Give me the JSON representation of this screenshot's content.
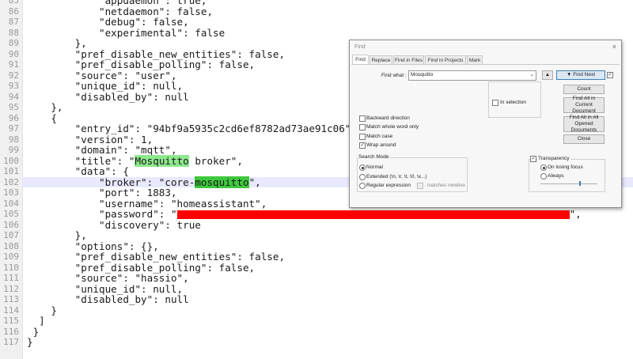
{
  "editor": {
    "first_line": 85,
    "current_line_index": 17,
    "line_numbers": [
      "85",
      "86",
      "87",
      "88",
      "89",
      "90",
      "91",
      "92",
      "93",
      "94",
      "95",
      "96",
      "97",
      "98",
      "99",
      "100",
      "101",
      "102",
      "103",
      "104",
      "105",
      "106",
      "107",
      "108",
      "109",
      "110",
      "111",
      "112",
      "113",
      "114",
      "115",
      "116",
      "117"
    ],
    "lines": [
      "            \"appdaemon\": true,",
      "            \"netdaemon\": false,",
      "            \"debug\": false,",
      "            \"experimental\": false",
      "        },",
      "        \"pref_disable_new_entities\": false,",
      "        \"pref_disable_polling\": false,",
      "        \"source\": \"user\",",
      "        \"unique_id\": null,",
      "        \"disabled_by\": null",
      "    },",
      "    {",
      "        \"entry_id\": \"94bf9a5935c2cd6ef8782ad73ae91c06\",",
      "        \"version\": 1,",
      "        \"domain\": \"mqtt\",",
      "        \"title\": \"",
      "        \"data\": {",
      "            \"broker\": \"core-",
      "            \"port\": 1883,",
      "            \"username\": \"homeassistant\",",
      "            \"password\": \"",
      "            \"discovery\": true",
      "        },",
      "        \"options\": {},",
      "        \"pref_disable_new_entities\": false,",
      "        \"pref_disable_polling\": false,",
      "        \"source\": \"hassio\",",
      "        \"unique_id\": null,",
      "        \"disabled_by\": null",
      "    }",
      "  ]",
      " }",
      "}"
    ],
    "title_match": "Mosquitto",
    "title_rest": " broker\",",
    "broker_match": "mosquitto",
    "broker_rest": "\",",
    "password_rest": "\","
  },
  "find_dialog": {
    "title": "Find",
    "close": "×",
    "tabs": [
      "Find",
      "Replace",
      "Find in Files",
      "Find in Projects",
      "Mark"
    ],
    "find_what_label": "Find what :",
    "find_what_value": "Mosquitto",
    "up_arrow": "▲",
    "find_next": "▼ Find Next",
    "count": "Count",
    "find_all_current": "Find All in Current Document",
    "find_all_opened": "Find All in All Opened Documents",
    "close_btn": "Close",
    "in_selection": "In selection",
    "backward": "Backward direction",
    "whole_word": "Match whole word only",
    "match_case": "Match case",
    "wrap_around": "Wrap around",
    "search_mode_title": "Search Mode",
    "mode_normal": "Normal",
    "mode_extended": "Extended (\\n, \\r, \\t, \\0, \\x...)",
    "mode_regex": "Regular expression",
    "matches_newline": ". matches newline",
    "transparency": "Transparency",
    "on_losing_focus": "On losing focus",
    "always": "Always",
    "transparency_level": 0.7
  }
}
